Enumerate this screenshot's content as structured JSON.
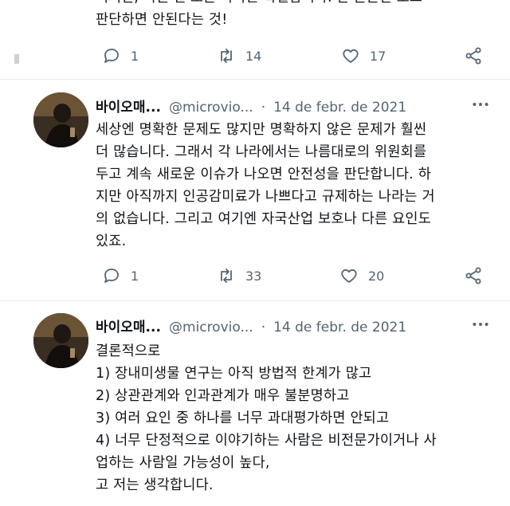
{
  "tweets": [
    {
      "text_lines": [
        "판단하면 안된다는 것!"
      ],
      "clipped_top_line": "이지만, 어떤 걸 보든 하나는 확실합니다. 한 논문만 보고",
      "replies": "1",
      "retweets": "14",
      "likes": "17"
    },
    {
      "name": "바이오매...",
      "handle": "@microvio...",
      "sep": "·",
      "date": "14 de febr. de 2021",
      "text_lines": [
        "세상엔 명확한 문제도 많지만 명확하지 않은 문제가 훨씬",
        "더 많습니다. 그래서 각 나라에서는 나름대로의 위원회를",
        "두고 계속 새로운 이슈가 나오면 안전성을 판단합니다. 하",
        "지만 아직까지 인공감미료가 나쁘다고 규제하는 나라는 거",
        "의 없습니다. 그리고 여기엔 자국산업 보호나 다른 요인도",
        "있죠."
      ],
      "replies": "1",
      "retweets": "33",
      "likes": "20"
    },
    {
      "name": "바이오매...",
      "handle": "@microvio...",
      "sep": "·",
      "date": "14 de febr. de 2021",
      "text_lines": [
        "결론적으로",
        "1) 장내미생물 연구는 아직 방법적 한계가 많고",
        "2) 상관관계와 인과관계가 매우 불분명하고",
        "3) 여러 요인 중 하나를 너무 과대평가하면 안되고",
        "4) 너무 단정적으로 이야기하는 사람은 비전문가이거나 사",
        "업하는 사람일 가능성이 높다,",
        "고 저는 생각합니다."
      ]
    }
  ],
  "icons": {
    "reply": "reply-icon",
    "retweet": "retweet-icon",
    "like": "heart-icon",
    "share": "share-icon",
    "more": "more-options-icon"
  },
  "colors": {
    "text": "#0f1419",
    "secondary": "#536471",
    "background": "#ffffff"
  }
}
